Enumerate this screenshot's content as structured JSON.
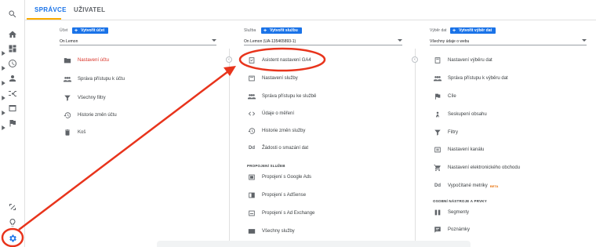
{
  "tabs": [
    "SPRÁVCE",
    "UŽIVATEL"
  ],
  "columns": {
    "account": {
      "label": "Účet",
      "create": "Vytvořit účet",
      "selected": "On Lemon",
      "items": [
        {
          "label": "Nastavení účtu",
          "icon": "building-icon",
          "red": true
        },
        {
          "label": "Správa přístupu k účtu",
          "icon": "people-icon"
        },
        {
          "label": "Všechny filtry",
          "icon": "filter-icon"
        },
        {
          "label": "Historie změn účtu",
          "icon": "history-icon"
        },
        {
          "label": "Koš",
          "icon": "trash-icon"
        }
      ]
    },
    "property": {
      "label": "Služba",
      "create": "Vytvořit službu",
      "selected": "On Lemon (UA-135465893-1)",
      "items": [
        {
          "label": "Asistent nastavení GA4",
          "icon": "checklist-icon"
        },
        {
          "label": "Nastavení služby",
          "icon": "property-settings-icon"
        },
        {
          "label": "Správa přístupu ke službě",
          "icon": "people-icon"
        },
        {
          "label": "Údaje o měření",
          "icon": "code-icon"
        },
        {
          "label": "Historie změn služby",
          "icon": "history-icon"
        },
        {
          "label": "Žádosti o smazání dat",
          "icon": "dd-icon",
          "glyph": "Dd"
        }
      ],
      "section": "PROPOJENÍ SLUŽEB",
      "links": [
        {
          "label": "Propojení s Google Ads",
          "icon": "ads-icon"
        },
        {
          "label": "Propojení s AdSense",
          "icon": "adsense-icon"
        },
        {
          "label": "Propojení s Ad Exchange",
          "icon": "adexchange-icon"
        },
        {
          "label": "Všechny služby",
          "icon": "all-products-icon"
        }
      ]
    },
    "view": {
      "label": "Výběr dat",
      "create": "Vytvořit výběr dat",
      "selected": "Všechny údaje o webu",
      "items": [
        {
          "label": "Nastavení výběru dat",
          "icon": "view-settings-icon"
        },
        {
          "label": "Správa přístupu k výběru dat",
          "icon": "people-icon"
        },
        {
          "label": "Cíle",
          "icon": "flag-icon"
        },
        {
          "label": "Seskupení obsahu",
          "icon": "person-icon"
        },
        {
          "label": "Filtry",
          "icon": "filter-icon"
        },
        {
          "label": "Nastavení kanálu",
          "icon": "channel-icon"
        },
        {
          "label": "Nastavení elektronického obchodu",
          "icon": "cart-icon"
        },
        {
          "label": "Vypočítané metriky",
          "icon": "dd-icon",
          "glyph": "Dd",
          "badge": "BETA"
        }
      ],
      "section": "OSOBNÍ NÁSTROJE A PRVKY",
      "tools": [
        {
          "label": "Segmenty",
          "icon": "segments-icon"
        },
        {
          "label": "Poznámky",
          "icon": "notes-icon"
        }
      ]
    }
  },
  "colors": {
    "accent": "#1a73e8",
    "tab_underline": "#f9ab00",
    "annotation": "#e8341c",
    "red_text": "#d93025"
  }
}
